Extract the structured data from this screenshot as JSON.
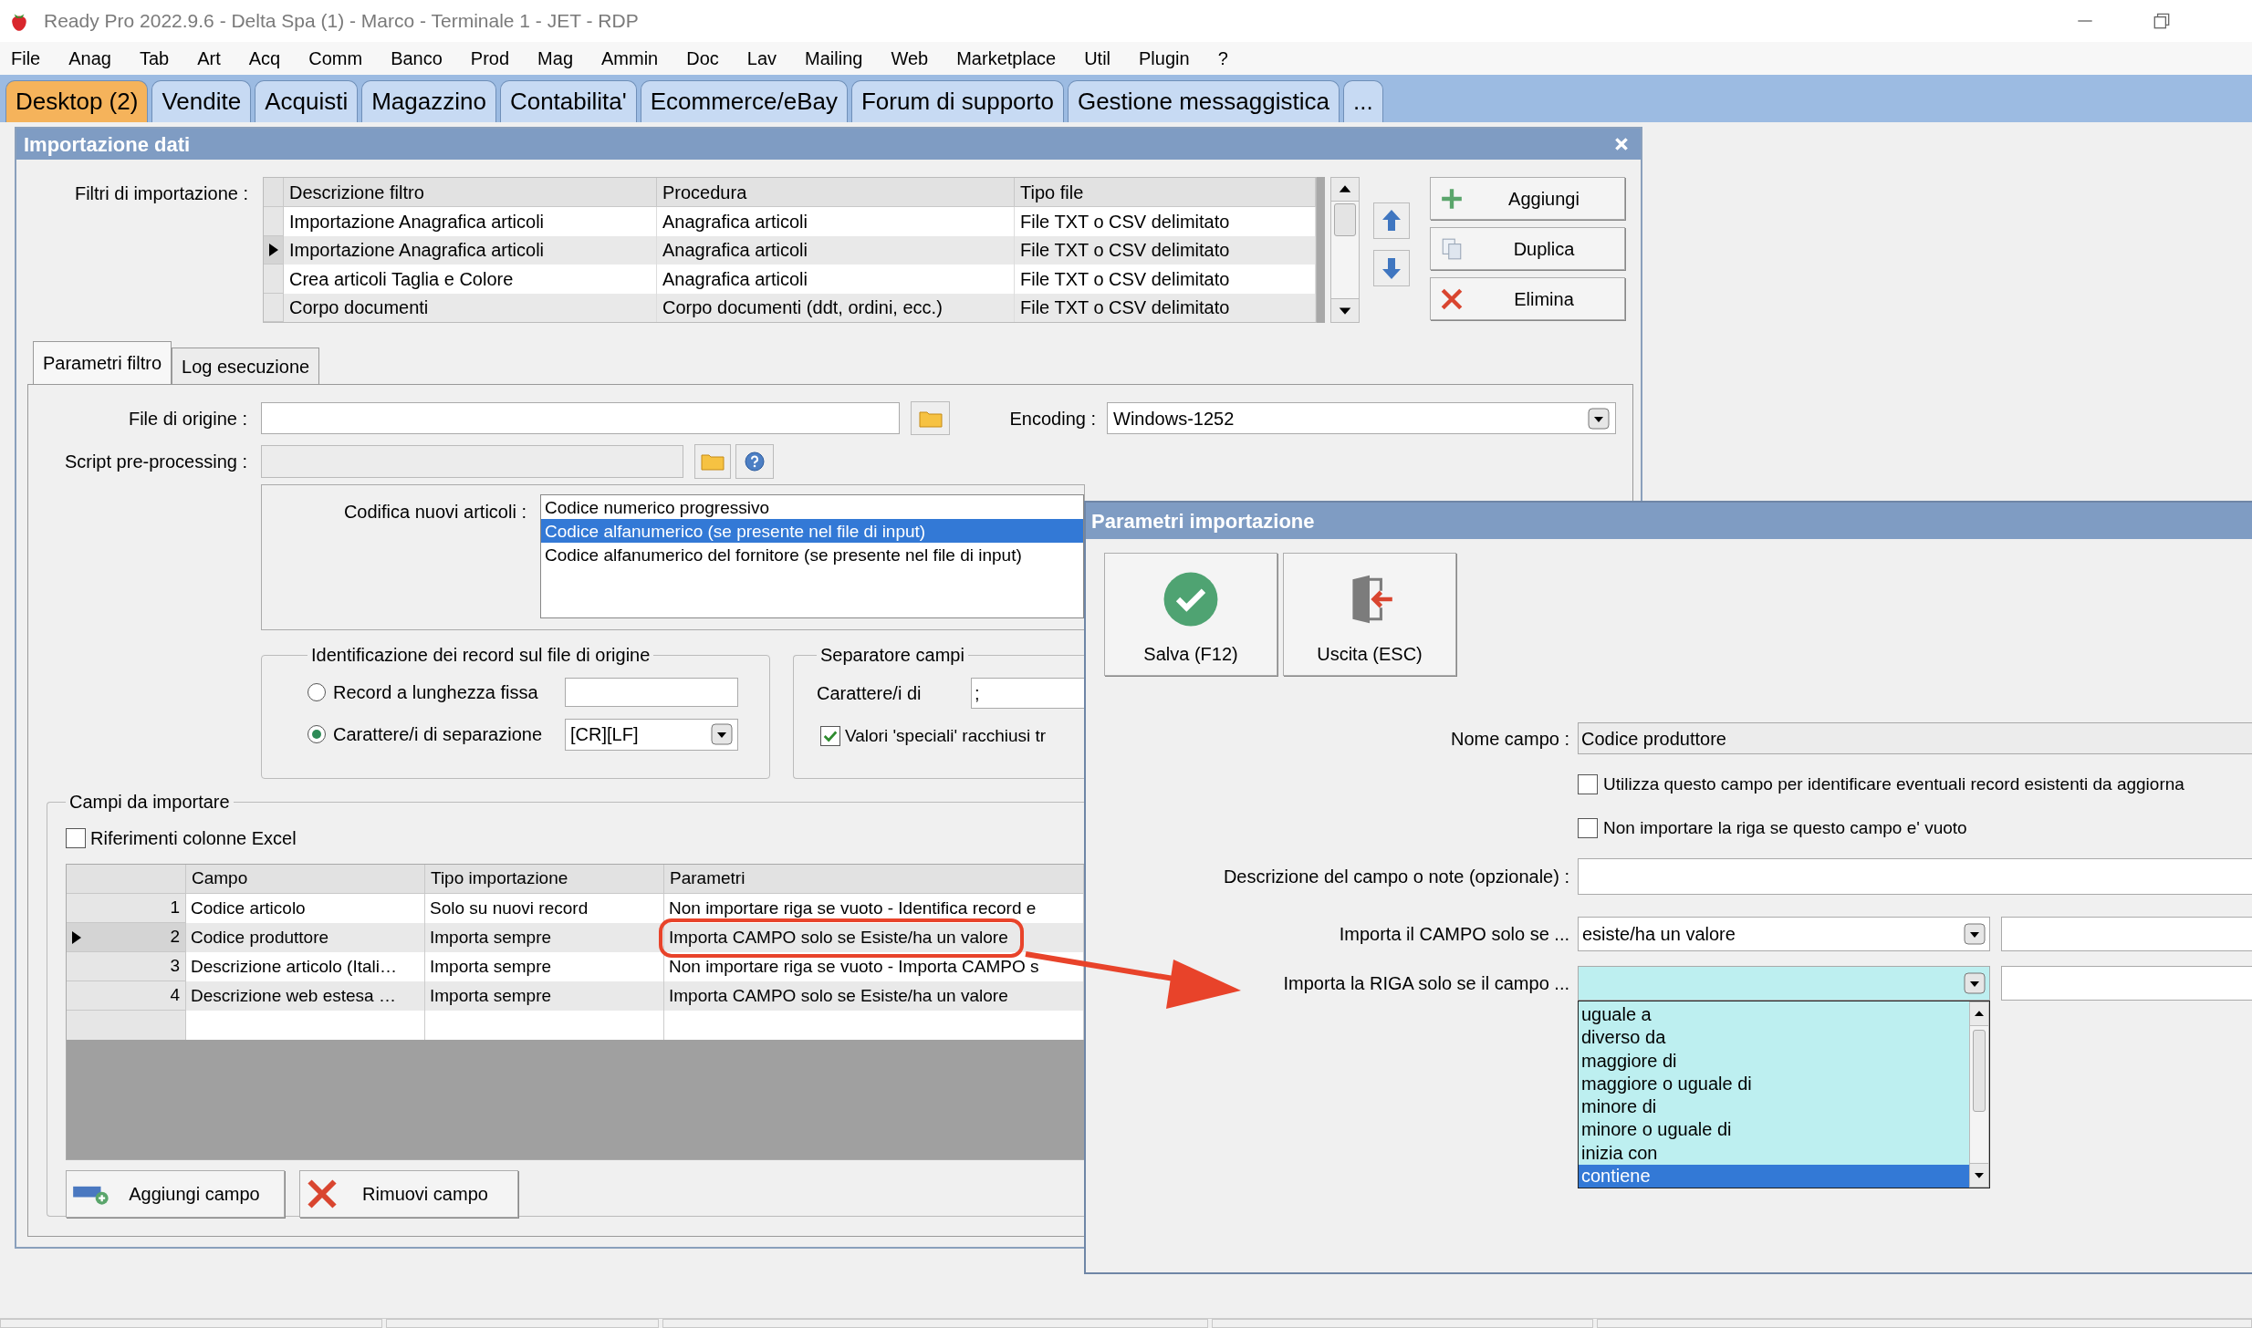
{
  "window": {
    "title": "Ready Pro 2022.9.6 - Delta Spa (1) - Marco - Terminale 1 - JET - RDP"
  },
  "menu": [
    "File",
    "Anag",
    "Tab",
    "Art",
    "Acq",
    "Comm",
    "Banco",
    "Prod",
    "Mag",
    "Ammin",
    "Doc",
    "Lav",
    "Mailing",
    "Web",
    "Marketplace",
    "Util",
    "Plugin",
    "?"
  ],
  "tabs": [
    {
      "label": "Desktop (2)",
      "selected": true
    },
    {
      "label": "Vendite",
      "selected": false
    },
    {
      "label": "Acquisti",
      "selected": false
    },
    {
      "label": "Magazzino",
      "selected": false
    },
    {
      "label": "Contabilita'",
      "selected": false
    },
    {
      "label": "Ecommerce/eBay",
      "selected": false
    },
    {
      "label": "Forum di supporto",
      "selected": false
    },
    {
      "label": "Gestione messaggistica",
      "selected": false
    },
    {
      "label": "...",
      "selected": false
    }
  ],
  "import_dialog": {
    "title": "Importazione dati",
    "filters_label": "Filtri di importazione :",
    "filters_columns": [
      "Descrizione filtro",
      "Procedura",
      "Tipo file"
    ],
    "filters_rows": [
      {
        "cells": [
          "Importazione Anagrafica articoli",
          "Anagrafica articoli",
          "File TXT o CSV delimitato"
        ],
        "selected": false
      },
      {
        "cells": [
          "Importazione Anagrafica articoli",
          "Anagrafica articoli",
          "File TXT o CSV delimitato"
        ],
        "selected": true
      },
      {
        "cells": [
          "Crea articoli Taglia e Colore",
          "Anagrafica articoli",
          "File TXT o CSV delimitato"
        ],
        "selected": false
      },
      {
        "cells": [
          "Corpo documenti",
          "Corpo documenti (ddt, ordini, ecc.)",
          "File TXT o CSV delimitato"
        ],
        "selected": false
      }
    ],
    "filter_buttons": [
      {
        "label": "Aggiungi",
        "kind": "add"
      },
      {
        "label": "Duplica",
        "kind": "copy"
      },
      {
        "label": "Elimina",
        "kind": "delete"
      }
    ],
    "subtabs": [
      {
        "label": "Parametri filtro",
        "selected": true
      },
      {
        "label": "Log esecuzione",
        "selected": false
      }
    ],
    "file_label": "File di origine :",
    "encoding": {
      "label": "Encoding :",
      "value": "Windows-1252"
    },
    "script_label": "Script pre-processing :",
    "coding": {
      "label": "Codifica nuovi articoli :",
      "options": [
        {
          "label": "Codice numerico progressivo",
          "selected": false
        },
        {
          "label": "Codice alfanumerico (se presente nel file di input)",
          "selected": true
        },
        {
          "label": "Codice alfanumerico del fornitore (se presente nel file di input)",
          "selected": false
        }
      ]
    },
    "record_id": {
      "title": "Identificazione dei record sul file di origine",
      "options": [
        {
          "label": "Record a lunghezza fissa",
          "selected": false
        },
        {
          "label": "Carattere/i di separazione",
          "selected": true
        }
      ],
      "separator": "[CR][LF]"
    },
    "field_separator": {
      "title": "Separatore campi",
      "label": "Carattere/i di",
      "value": ";",
      "special": {
        "label": "Valori 'speciali' racchiusi tr",
        "checked": true
      }
    },
    "fields": {
      "title": "Campi da importare",
      "excel_refs": {
        "label": "Riferimenti colonne Excel",
        "checked": false
      },
      "columns": [
        "Campo",
        "Tipo importazione",
        "Parametri"
      ],
      "rows": [
        {
          "number": "1",
          "cells": [
            "Codice articolo",
            "Solo su nuovi record",
            "Non importare riga se vuoto - Identifica record e"
          ],
          "selected": false
        },
        {
          "number": "2",
          "cells": [
            "Codice produttore",
            "Importa sempre",
            "Importa CAMPO solo se Esiste/ha un valore"
          ],
          "selected": true
        },
        {
          "number": "3",
          "cells": [
            "Descrizione articolo (Itali…",
            "Importa sempre",
            "Non importare riga se vuoto - Importa CAMPO s"
          ],
          "selected": false
        },
        {
          "number": "4",
          "cells": [
            "Descrizione web estesa …",
            "Importa sempre",
            "Importa CAMPO solo se Esiste/ha un valore"
          ],
          "selected": false
        }
      ],
      "buttons": [
        {
          "label": "Aggiungi campo",
          "kind": "add_field"
        },
        {
          "label": "Rimuovi campo",
          "kind": "remove"
        }
      ]
    }
  },
  "params_dialog": {
    "title": "Parametri importazione",
    "buttons": [
      {
        "label": "Salva (F12)",
        "kind": "save"
      },
      {
        "label": "Uscita (ESC)",
        "kind": "exit"
      }
    ],
    "name_label": "Nome campo :",
    "name_value": "Codice produttore",
    "checks": [
      {
        "label": "Utilizza questo campo per identificare eventuali record esistenti da aggiorna",
        "checked": false
      },
      {
        "label": "Non importare la riga se questo campo e' vuoto",
        "checked": false
      }
    ],
    "description_label": "Descrizione del campo o note (opzionale) :",
    "field_condition": {
      "label": "Importa il CAMPO solo se ...",
      "value": "esiste/ha un valore"
    },
    "row_condition": {
      "label": "Importa la RIGA solo se il campo ...",
      "options": [
        {
          "label": "uguale a",
          "selected": false
        },
        {
          "label": "diverso da",
          "selected": false
        },
        {
          "label": "maggiore di",
          "selected": false
        },
        {
          "label": "maggiore o uguale di",
          "selected": false
        },
        {
          "label": "minore di",
          "selected": false
        },
        {
          "label": "minore o uguale di",
          "selected": false
        },
        {
          "label": "inizia con",
          "selected": false
        },
        {
          "label": "contiene",
          "selected": true
        }
      ]
    }
  }
}
